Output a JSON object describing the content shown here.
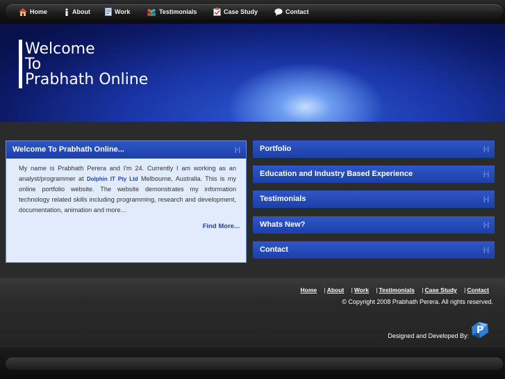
{
  "nav": {
    "items": [
      {
        "label": "Home",
        "icon": "home-icon"
      },
      {
        "label": "About",
        "icon": "info-icon"
      },
      {
        "label": "Work",
        "icon": "document-icon"
      },
      {
        "label": "Testimonials",
        "icon": "people-icon"
      },
      {
        "label": "Case Study",
        "icon": "clipboard-icon"
      },
      {
        "label": "Contact",
        "icon": "speech-bubble-icon"
      }
    ]
  },
  "banner": {
    "line1": "Welcome",
    "line2": "To",
    "line3": "Prabhath Online"
  },
  "welcome": {
    "title": "Welcome To Prabhath Online...",
    "text_before": "My name is Prabhath Perera and I'm 24. Currently I am working as an analyst/programmer at",
    "company": "Dolphin IT Pty Ltd",
    "text_after": "Melbourne, Australia. This is my online portfolio website. The website demonstrates my information technology related skills including programming, research and development, documentation, animation and more…",
    "find_more": "Find More..."
  },
  "accordion": [
    "Portfolio",
    "Education and Industry Based Experience",
    "Testimonials",
    "Whats New?",
    "Contact"
  ],
  "collapse_glyph": "|-|",
  "footer": {
    "links": [
      "Home",
      "About",
      "Work",
      "Testimonials",
      "Case Study",
      "Contact"
    ],
    "separator": "|",
    "copyright": "© Copyright 2008 Prabhath Perera. All rights reserved.",
    "designed_by": "Designed and Developed By:",
    "logo_letter": "P"
  },
  "colors": {
    "accent": "#1d3fa8",
    "panel_bg": "#e2ebfb",
    "link": "#1f44b0"
  }
}
